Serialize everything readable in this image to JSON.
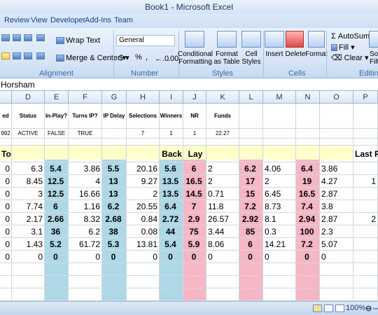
{
  "window": {
    "title": "Book1 - Microsoft Excel"
  },
  "tabs": [
    "Review",
    "View",
    "Developer",
    "Add-Ins",
    "Team"
  ],
  "ribbon": {
    "alignment": {
      "wrap_text": "Wrap Text",
      "merge_center": "Merge & Center",
      "label": "Alignment"
    },
    "number": {
      "format_value": "General",
      "currency": "$",
      "percent": "%",
      "comma": ",",
      "label": "Number"
    },
    "styles": {
      "conditional": "Conditional Formatting",
      "format_table": "Format as Table",
      "cell_styles": "Cell Styles",
      "label": "Styles"
    },
    "cells": {
      "insert": "Insert",
      "delete": "Delete",
      "format": "Format",
      "label": "Cells"
    },
    "editing": {
      "autosum": "AutoSum",
      "fill": "Fill",
      "clear": "Clear",
      "sort": "Sor",
      "filter": "Filt",
      "label": "Editing"
    }
  },
  "formula_bar": {
    "value": "Horsham"
  },
  "columns": [
    "D",
    "E",
    "F",
    "G",
    "H",
    "I",
    "J",
    "K",
    "L",
    "M",
    "N",
    "O",
    "P"
  ],
  "header_row": {
    "A": "ed",
    "D": "Status",
    "E": "In-Play?",
    "F": "Turns IP?",
    "G": "IP Delay",
    "H": "Selections",
    "I": "Winners",
    "J": "NR",
    "K": "Funds"
  },
  "value_row": {
    "A": "992",
    "D": "ACTIVE",
    "E": "FALSE",
    "F": "TRUE",
    "G": "",
    "H": "7",
    "I": "1",
    "J": "1",
    "K": "22.27"
  },
  "label_row": {
    "A": "To",
    "I": "Back",
    "J": "Lay",
    "P": "Last Pr"
  },
  "rows": [
    [
      "0",
      "6.3",
      "5.4",
      "3.86",
      "5.5",
      "20.16",
      "5.6",
      "6",
      "2",
      "6.2",
      "4.06",
      "6.4",
      "3.86",
      ""
    ],
    [
      "0",
      "8.45",
      "12.5",
      "4",
      "13",
      "9.27",
      "13.5",
      "16.5",
      "2",
      "17",
      "2",
      "19",
      "4.27",
      "1"
    ],
    [
      "0",
      "3",
      "12.5",
      "16.66",
      "13",
      "2",
      "13.5",
      "14.5",
      "0.71",
      "15",
      "6.45",
      "16.5",
      "2.87",
      ""
    ],
    [
      "0",
      "7.74",
      "6",
      "1.16",
      "6.2",
      "20.55",
      "6.4",
      "7",
      "11.8",
      "7.2",
      "8.73",
      "7.4",
      "3.8",
      ""
    ],
    [
      "0",
      "2.17",
      "2.66",
      "8.32",
      "2.68",
      "0.84",
      "2.72",
      "2.9",
      "26.57",
      "2.92",
      "8.1",
      "2.94",
      "2.87",
      "2"
    ],
    [
      "0",
      "3.1",
      "36",
      "6.2",
      "38",
      "0.08",
      "44",
      "75",
      "3.44",
      "85",
      "0.3",
      "100",
      "2.3",
      ""
    ],
    [
      "0",
      "1.43",
      "5.2",
      "61.72",
      "5.3",
      "13.81",
      "5.4",
      "5.9",
      "8.06",
      "6",
      "14.21",
      "7.2",
      "5.07",
      ""
    ],
    [
      "0",
      "0",
      "0",
      "0",
      "0",
      "0",
      "0",
      "0",
      "0",
      "0",
      "0",
      "0",
      "0",
      ""
    ]
  ],
  "status_bar": {
    "zoom": "100%"
  },
  "colors": {
    "back_blue": "#aed8e6",
    "lay_pink": "#f7b6c3",
    "label_yellow": "#ffffcc"
  }
}
